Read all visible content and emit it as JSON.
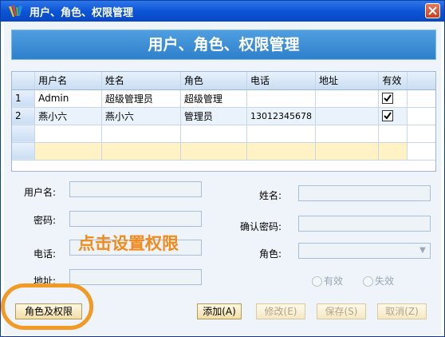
{
  "window": {
    "title": "用户、角色、权限管理",
    "close_symbol": "×"
  },
  "banner": {
    "text": "用户、角色、权限管理"
  },
  "grid": {
    "columns": [
      "用户名",
      "姓名",
      "角色",
      "电话",
      "地址",
      "有效"
    ],
    "rows": [
      {
        "num": "1",
        "username": "Admin",
        "name": "超级管理员",
        "role": "超级管理",
        "phone": "",
        "address": "",
        "valid": true
      },
      {
        "num": "2",
        "username": "燕小六",
        "name": "燕小六",
        "role": "管理员",
        "phone": "13012345678",
        "address": "",
        "valid": true
      }
    ]
  },
  "form": {
    "username_label": "用户名:",
    "name_label": "姓名:",
    "password_label": "密码:",
    "confirm_label": "确认密码:",
    "phone_label": "电话:",
    "role_label": "角色:",
    "address_label": "地址:",
    "radio_valid": "有效",
    "radio_invalid": "失效"
  },
  "buttons": {
    "role_permission": "角色及权限",
    "add": "添加(A)",
    "edit": "修改(E)",
    "save": "保存(S)",
    "cancel": "取消(Z)"
  },
  "annotation": {
    "text": "点击设置权限"
  },
  "colors": {
    "accent_orange": "#f39a24",
    "banner_blue": "#3a8ad4",
    "titlebar_blue": "#0b55d6"
  }
}
